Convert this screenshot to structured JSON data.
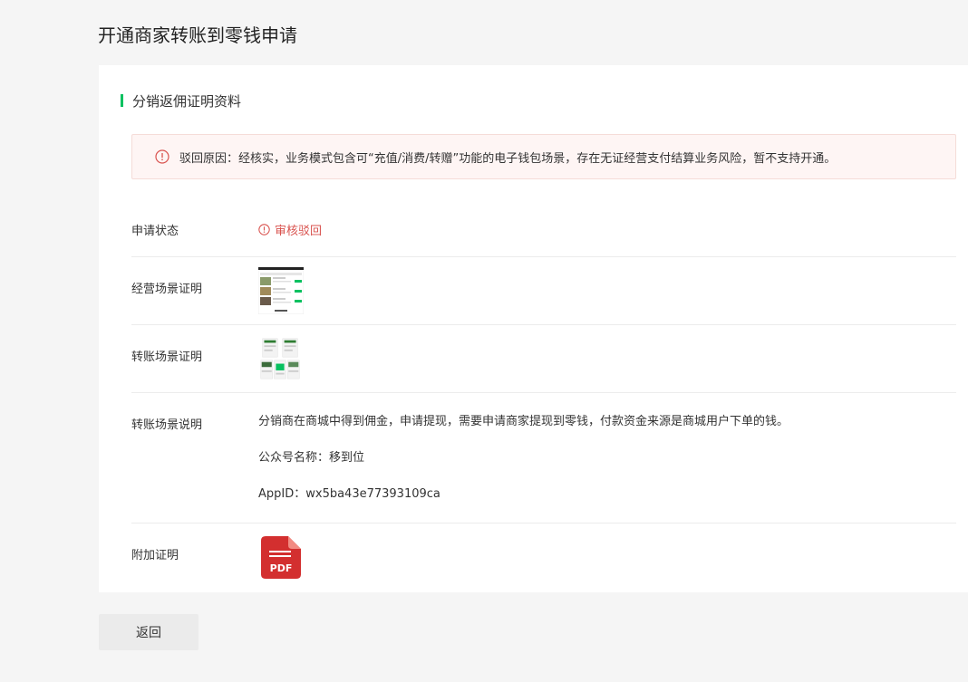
{
  "page": {
    "title": "开通商家转账到零钱申请"
  },
  "section": {
    "title": "分销返佣证明资料"
  },
  "alert": {
    "icon": "warning-circle-icon",
    "text": "驳回原因：经核实，业务模式包含可“充值/消费/转赠”功能的电子钱包场景，存在无证经营支付结算业务风险，暂不支持开通。",
    "color": "#d9534f"
  },
  "rows": {
    "status": {
      "label": "申请状态",
      "value": "审核驳回",
      "icon": "warning-circle-icon"
    },
    "business_proof": {
      "label": "经营场景证明"
    },
    "transfer_proof": {
      "label": "转账场景证明"
    },
    "transfer_desc": {
      "label": "转账场景说明",
      "lines": [
        "分销商在商城中得到佣金，申请提现，需要申请商家提现到零钱，付款资金来源是商城用户下单的钱。",
        "公众号名称：移到位",
        "AppID：wx5ba43e77393109ca"
      ]
    },
    "attachment": {
      "label": "附加证明",
      "file_label": "PDF",
      "icon": "pdf-file-icon"
    }
  },
  "footer": {
    "back_label": "返回"
  },
  "colors": {
    "accent": "#07c160",
    "error": "#d9534f",
    "pdf": "#d32f2f"
  }
}
